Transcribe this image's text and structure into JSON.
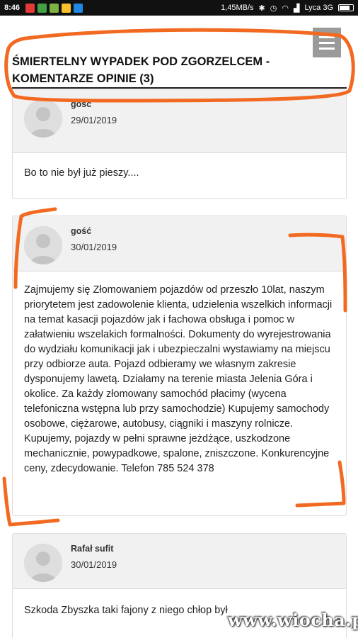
{
  "status_bar": {
    "time": "8:46",
    "speed": "1,45MB/s",
    "carrier": "Lyca 3G",
    "app_icon_colors": [
      "#e53935",
      "#43a047",
      "#7cb342",
      "#fbc02d",
      "#1e88e5"
    ]
  },
  "header": {
    "title": "ŚMIERTELNY WYPADEK POD ZGORZELCEM - KOMENTARZE OPINIE (3)",
    "menu_icon": "hamburger-icon"
  },
  "comments": [
    {
      "author": "gość",
      "date": "29/01/2019",
      "text": "Bo to nie był już pieszy...."
    },
    {
      "author": "gość",
      "date": "30/01/2019",
      "text": "Zajmujemy się Złomowaniem pojazdów od przeszło 10lat, naszym priorytetem jest zadowolenie klienta, udzielenia wszelkich informacji na temat kasacji pojazdów jak i fachowa obsługa i pomoc w załatwieniu wszelakich formalności. Dokumenty do wyrejestrowania do wydziału komunikacji jak i ubezpieczalni wystawiamy na miejscu przy odbiorze auta. Pojazd odbieramy we własnym zakresie dysponujemy lawetą. Działamy na terenie miasta Jelenia Góra i okolice. Za każdy złomowany samochód płacimy (wycena telefoniczna wstępna lub przy samochodzie) Kupujemy samochody osobowe, ciężarowe, autobusy, ciągniki i maszyny rolnicze. Kupujemy, pojazdy w pełni sprawne jeżdżące, uszkodzone mechanicznie, powypadkowe, spalone, zniszczone. Konkurencyjne ceny, zdecydowanie. Telefon 785 524 378"
    },
    {
      "author": "Rafał sufit",
      "date": "30/01/2019",
      "text": "Szkoda Zbyszka taki fajony z niego chłop był"
    }
  ],
  "watermark": "www.wiocha.pl",
  "annotation_color": "#f26a21"
}
